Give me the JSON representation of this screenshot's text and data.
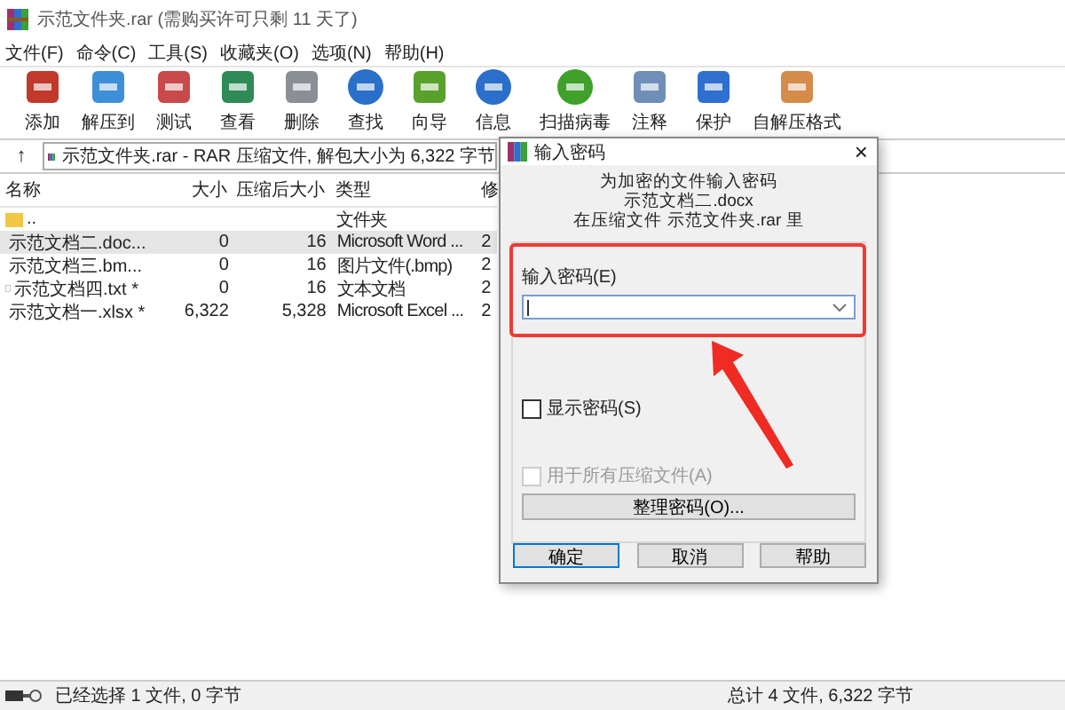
{
  "window": {
    "title": "示范文件夹.rar (需购买许可只剩 11 天了)"
  },
  "menu": [
    "文件(F)",
    "命令(C)",
    "工具(S)",
    "收藏夹(O)",
    "选项(N)",
    "帮助(H)"
  ],
  "toolbar": [
    "添加",
    "解压到",
    "测试",
    "查看",
    "删除",
    "查找",
    "向导",
    "信息",
    "扫描病毒",
    "注释",
    "保护",
    "自解压格式"
  ],
  "address": {
    "up": "↑",
    "text": "示范文件夹.rar - RAR 压缩文件, 解包大小为 6,322 字节"
  },
  "table": {
    "columns": [
      "名称",
      "大小",
      "压缩后大小",
      "类型",
      "修"
    ],
    "rows": [
      {
        "kind": "folder",
        "selected": false,
        "cells": [
          "..",
          "",
          "",
          "文件夹",
          ""
        ]
      },
      {
        "kind": "word",
        "selected": true,
        "cells": [
          "示范文档二.doc...",
          "0",
          "16",
          "Microsoft Word ...",
          "2"
        ]
      },
      {
        "kind": "image",
        "selected": false,
        "cells": [
          "示范文档三.bm...",
          "0",
          "16",
          "图片文件(.bmp)",
          "2"
        ]
      },
      {
        "kind": "text",
        "selected": false,
        "cells": [
          "示范文档四.txt *",
          "0",
          "16",
          "文本文档",
          "2"
        ]
      },
      {
        "kind": "excel",
        "selected": false,
        "cells": [
          "示范文档一.xlsx *",
          "6,322",
          "5,328",
          "Microsoft Excel ...",
          "2"
        ]
      }
    ]
  },
  "dialog": {
    "title": "输入密码",
    "close": "×",
    "lines": [
      "为加密的文件输入密码",
      "示范文档二.docx",
      "在压缩文件 示范文件夹.rar 里"
    ],
    "password_label": "输入密码(E)",
    "checkboxes": [
      {
        "label": "显示密码(S)",
        "checked": false,
        "disabled": false
      },
      {
        "label": "用于所有压缩文件(A)",
        "checked": false,
        "disabled": true
      }
    ],
    "organize_button": "整理密码(O)...",
    "buttons": [
      {
        "label": "确定",
        "default": true
      },
      {
        "label": "取消",
        "default": false
      },
      {
        "label": "帮助",
        "default": false
      }
    ]
  },
  "status_bar": {
    "left": "已经选择 1 文件, 0 字节",
    "right": "总计 4 文件, 6,322 字节"
  }
}
